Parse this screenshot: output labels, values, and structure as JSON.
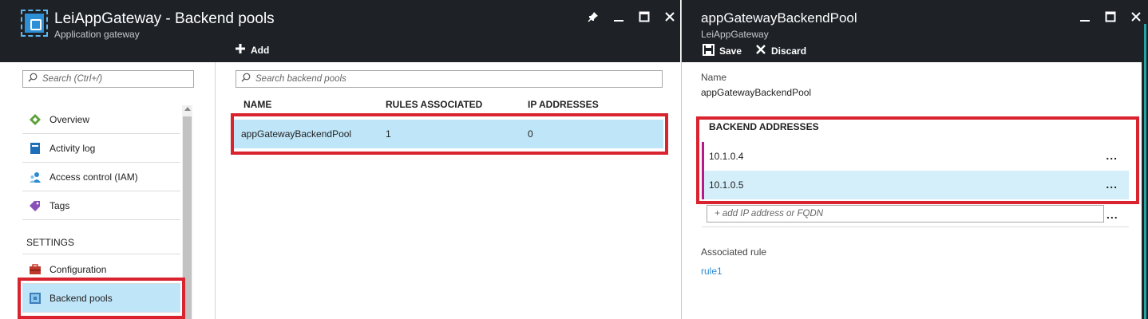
{
  "left_blade": {
    "title": "LeiAppGateway - Backend pools",
    "subtitle": "Application gateway",
    "add_label": "Add"
  },
  "menu": {
    "search_placeholder": "Search (Ctrl+/)",
    "items": [
      {
        "label": "Overview",
        "icon": "overview-icon"
      },
      {
        "label": "Activity log",
        "icon": "activity-log-icon"
      },
      {
        "label": "Access control (IAM)",
        "icon": "iam-icon"
      },
      {
        "label": "Tags",
        "icon": "tag-icon"
      }
    ],
    "settings_label": "SETTINGS",
    "settings_items": [
      {
        "label": "Configuration",
        "icon": "configuration-icon"
      },
      {
        "label": "Backend pools",
        "icon": "backend-pools-icon",
        "selected": true
      }
    ]
  },
  "pools": {
    "search_placeholder": "Search backend pools",
    "columns": [
      "NAME",
      "RULES ASSOCIATED",
      "IP ADDRESSES"
    ],
    "rows": [
      {
        "name": "appGatewayBackendPool",
        "rules": "1",
        "ips": "0"
      }
    ]
  },
  "right_blade": {
    "title": "appGatewayBackendPool",
    "subtitle": "LeiAppGateway",
    "save_label": "Save",
    "discard_label": "Discard",
    "name_label": "Name",
    "name_value": "appGatewayBackendPool",
    "backend_addresses_label": "BACKEND ADDRESSES",
    "addresses": [
      "10.1.0.4",
      "10.1.0.5"
    ],
    "more_label": "...",
    "add_placeholder": "+ add IP address or FQDN",
    "associated_rule_label": "Associated rule",
    "associated_rule_value": "rule1"
  },
  "colors": {
    "header_bg": "#1e2227",
    "selected_bg": "#bfe5f8",
    "highlight_red": "#d9232e",
    "link_blue": "#2a8ad4",
    "row_accent": "#b9188a"
  }
}
